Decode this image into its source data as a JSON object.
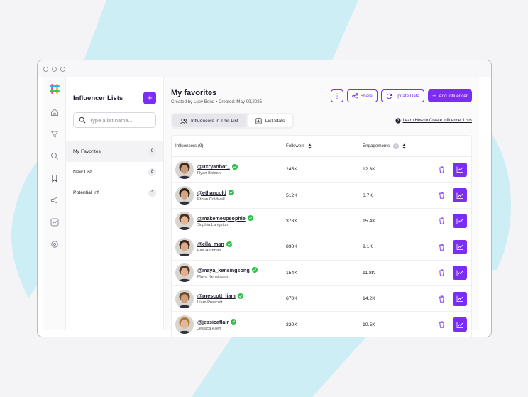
{
  "colors": {
    "accent": "#7b2cf5",
    "verified": "#2fbf4b",
    "bg_shape": "#cdeef4"
  },
  "sidebar": {
    "icons": [
      "home-icon",
      "filter-icon",
      "search-icon",
      "bookmark-icon",
      "megaphone-icon",
      "trend-icon",
      "settings-icon"
    ]
  },
  "lists_panel": {
    "title": "Influencer Lists",
    "add_label": "+",
    "search_placeholder": "Type a list name...",
    "items": [
      {
        "label": "My Favorites",
        "count": "9"
      },
      {
        "label": "New List",
        "count": "8"
      },
      {
        "label": "Potential Inf.",
        "count": "4"
      }
    ]
  },
  "main": {
    "title": "My favorites",
    "created_by": "Created by Lucy Bond",
    "created_on": "Created: May 09,2025",
    "actions": {
      "more": "⋮",
      "share": "Share",
      "update": "Update Data",
      "add": "Add Influencer"
    },
    "tabs": [
      "Influencers In This List",
      "List Stats"
    ],
    "learn_link": "Learn How to Create Influencer Lists"
  },
  "table": {
    "headers": {
      "name": "Influencers (9)",
      "followers": "Followers",
      "engagements": "Engagements"
    },
    "rows": [
      {
        "handle": "@uxryanbot_",
        "name": "Ryan Bolosh",
        "followers": "245K",
        "engagements": "12.3K",
        "skin": "#c89a7a",
        "hair": "#3a2a20"
      },
      {
        "handle": "@ethancold",
        "name": "Ethan Coldwell",
        "followers": "512K",
        "engagements": "8.7K",
        "skin": "#d4a583",
        "hair": "#2b1d14"
      },
      {
        "handle": "@makemeupsophie",
        "name": "Sophia Langston",
        "followers": "378K",
        "engagements": "15.4K",
        "skin": "#e2b596",
        "hair": "#4a2e1e"
      },
      {
        "handle": "@ella_man",
        "name": "Ella Hartman",
        "followers": "890K",
        "engagements": "9.1K",
        "skin": "#d9a98a",
        "hair": "#3b261a"
      },
      {
        "handle": "@maya_kensingsong",
        "name": "Maya Kensington",
        "followers": "154K",
        "engagements": "11.8K",
        "skin": "#e0b091",
        "hair": "#5a3826"
      },
      {
        "handle": "@prescott_liam",
        "name": "Liam Prescott",
        "followers": "670K",
        "engagements": "14.2K",
        "skin": "#cf9e7f",
        "hair": "#6b4a30"
      },
      {
        "handle": "@jessicaflair",
        "name": "Jessica Allen",
        "followers": "320K",
        "engagements": "10.5K",
        "skin": "#e6b798",
        "hair": "#b07a3e"
      }
    ]
  }
}
